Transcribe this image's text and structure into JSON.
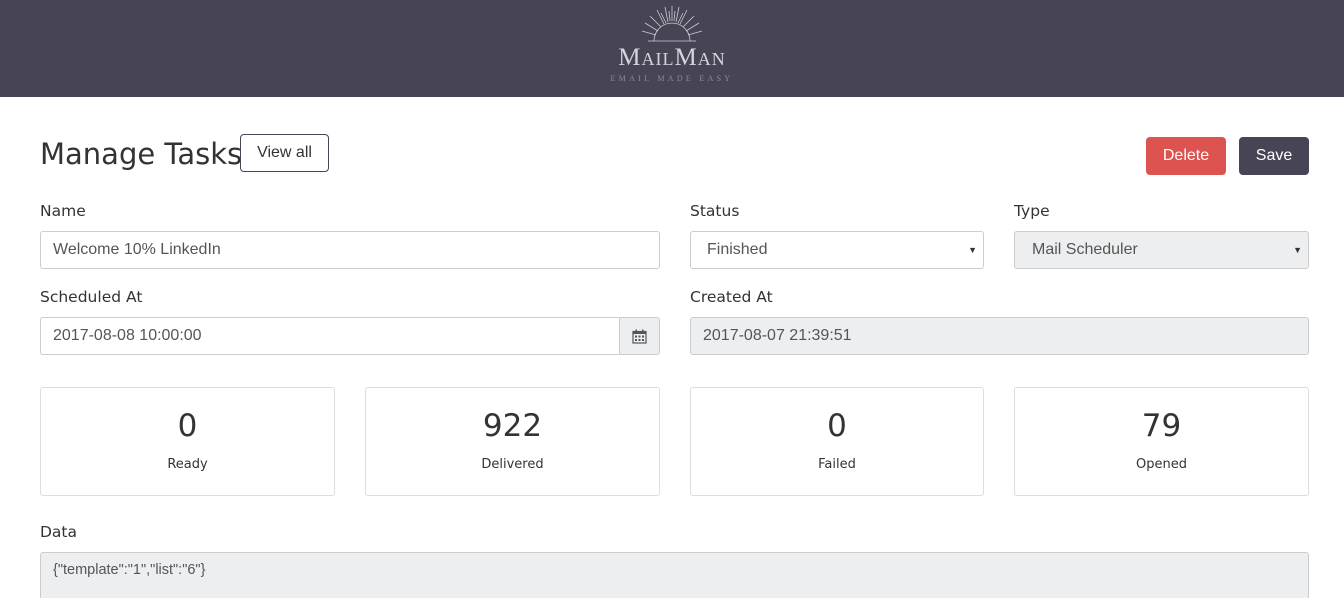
{
  "brand": {
    "name": "MailMan",
    "tagline": "EMAIL MADE EASY",
    "bar_color": "#474455"
  },
  "header": {
    "title": "Manage Tasks",
    "view_all_label": "View all",
    "delete_label": "Delete",
    "save_label": "Save"
  },
  "form": {
    "name": {
      "label": "Name",
      "value": "Welcome 10% LinkedIn"
    },
    "status": {
      "label": "Status",
      "value": "Finished"
    },
    "type": {
      "label": "Type",
      "value": "Mail Scheduler"
    },
    "scheduled_at": {
      "label": "Scheduled At",
      "value": "2017-08-08 10:00:00"
    },
    "created_at": {
      "label": "Created At",
      "value": "2017-08-07 21:39:51"
    },
    "data": {
      "label": "Data",
      "value": "{\"template\":\"1\",\"list\":\"6\"}"
    }
  },
  "stats": [
    {
      "value": "0",
      "label": "Ready"
    },
    {
      "value": "922",
      "label": "Delivered"
    },
    {
      "value": "0",
      "label": "Failed"
    },
    {
      "value": "79",
      "label": "Opened"
    }
  ],
  "icons": {
    "calendar": "calendar-icon",
    "sunburst": "sunburst-logo-icon",
    "dropdown": "caret-down-icon"
  },
  "colors": {
    "delete": "#dc5350",
    "save": "#474455",
    "readonly_bg": "#eceeef"
  }
}
